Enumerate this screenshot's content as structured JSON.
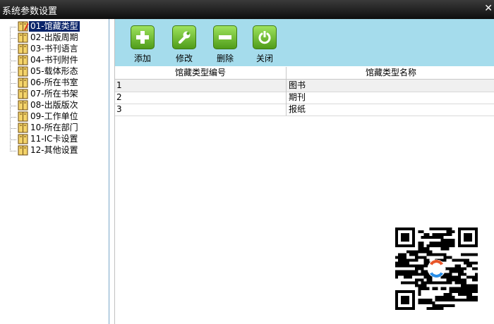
{
  "window": {
    "title": "系统参数设置",
    "close_label": "✕"
  },
  "tree": {
    "items": [
      {
        "label": "01-馆藏类型",
        "selected": true
      },
      {
        "label": "02-出版周期"
      },
      {
        "label": "03-书刊语言"
      },
      {
        "label": "04-书刊附件"
      },
      {
        "label": "05-载体形态"
      },
      {
        "label": "06-所在书室"
      },
      {
        "label": "07-所在书架"
      },
      {
        "label": "08-出版版次"
      },
      {
        "label": "09-工作单位"
      },
      {
        "label": "10-所在部门"
      },
      {
        "label": "11-IC卡设置"
      },
      {
        "label": "12-其他设置"
      }
    ]
  },
  "toolbar": {
    "add_label": "添加",
    "edit_label": "修改",
    "delete_label": "删除",
    "close_label": "关闭"
  },
  "grid": {
    "headers": [
      "馆藏类型编号",
      "馆藏类型名称"
    ],
    "rows": [
      [
        "1",
        "图书"
      ],
      [
        "2",
        "期刊"
      ],
      [
        "3",
        "报纸"
      ]
    ]
  },
  "colors": {
    "toolbar_bg": "#a5dcec",
    "button_green": "#6fbe2c",
    "selection": "#0a246a"
  }
}
